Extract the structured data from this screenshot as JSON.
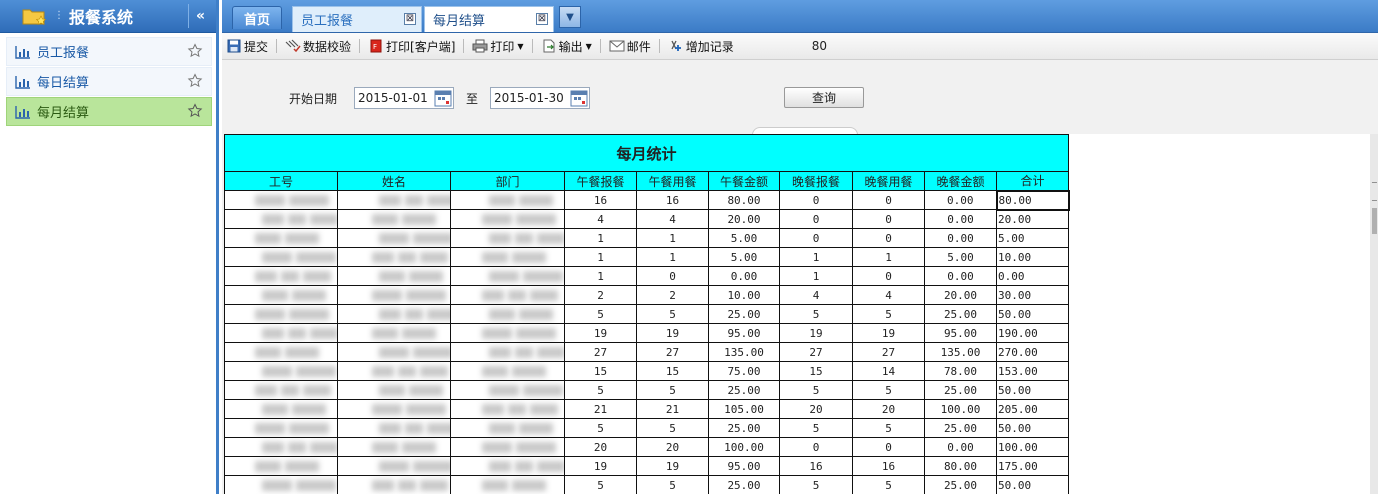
{
  "sidebar": {
    "title": "报餐系统",
    "collapse_label": "«",
    "items": [
      {
        "label": "员工报餐",
        "active": false
      },
      {
        "label": "每日结算",
        "active": false
      },
      {
        "label": "每月结算",
        "active": true
      }
    ]
  },
  "tabs": {
    "home": "首页",
    "open": [
      {
        "label": "员工报餐",
        "close": "⊠"
      },
      {
        "label": "每月结算",
        "close": "⊠"
      }
    ]
  },
  "toolbar": {
    "submit": "提交",
    "validate": "数据校验",
    "print_client": "打印[客户端]",
    "print": "打印",
    "export": "输出",
    "mail": "邮件",
    "add_record": "增加记录",
    "value": "80"
  },
  "query": {
    "start_label": "开始日期",
    "start_date": "2015-01-01",
    "to_label": "至",
    "end_date": "2015-01-30",
    "button": "查询"
  },
  "report": {
    "title": "每月统计",
    "headers": [
      "工号",
      "姓名",
      "部门",
      "午餐报餐",
      "午餐用餐",
      "午餐金额",
      "晚餐报餐",
      "晚餐用餐",
      "晚餐金额",
      "合计"
    ],
    "rows": [
      [
        "16",
        "16",
        "80.00",
        "0",
        "0",
        "0.00",
        "80.00"
      ],
      [
        "4",
        "4",
        "20.00",
        "0",
        "0",
        "0.00",
        "20.00"
      ],
      [
        "1",
        "1",
        "5.00",
        "0",
        "0",
        "0.00",
        "5.00"
      ],
      [
        "1",
        "1",
        "5.00",
        "1",
        "1",
        "5.00",
        "10.00"
      ],
      [
        "1",
        "0",
        "0.00",
        "1",
        "0",
        "0.00",
        "0.00"
      ],
      [
        "2",
        "2",
        "10.00",
        "4",
        "4",
        "20.00",
        "30.00"
      ],
      [
        "5",
        "5",
        "25.00",
        "5",
        "5",
        "25.00",
        "50.00"
      ],
      [
        "19",
        "19",
        "95.00",
        "19",
        "19",
        "95.00",
        "190.00"
      ],
      [
        "27",
        "27",
        "135.00",
        "27",
        "27",
        "135.00",
        "270.00"
      ],
      [
        "15",
        "15",
        "75.00",
        "15",
        "14",
        "78.00",
        "153.00"
      ],
      [
        "5",
        "5",
        "25.00",
        "5",
        "5",
        "25.00",
        "50.00"
      ],
      [
        "21",
        "21",
        "105.00",
        "20",
        "20",
        "100.00",
        "205.00"
      ],
      [
        "5",
        "5",
        "25.00",
        "5",
        "5",
        "25.00",
        "50.00"
      ],
      [
        "20",
        "20",
        "100.00",
        "0",
        "0",
        "0.00",
        "100.00"
      ],
      [
        "19",
        "19",
        "95.00",
        "16",
        "16",
        "80.00",
        "175.00"
      ],
      [
        "5",
        "5",
        "25.00",
        "5",
        "5",
        "25.00",
        "50.00"
      ]
    ]
  },
  "colors": {
    "header_blue": "#3b7bc6",
    "active_green": "#b9e59b",
    "report_cyan": "#00ffff"
  },
  "icons": [
    "folder-star-icon",
    "collapse-icon",
    "chart-icon",
    "star-icon",
    "close-icon",
    "dropdown-icon",
    "save-icon",
    "check-icon",
    "pdf-icon",
    "printer-icon",
    "export-icon",
    "mail-icon",
    "add-record-icon",
    "calendar-icon"
  ]
}
